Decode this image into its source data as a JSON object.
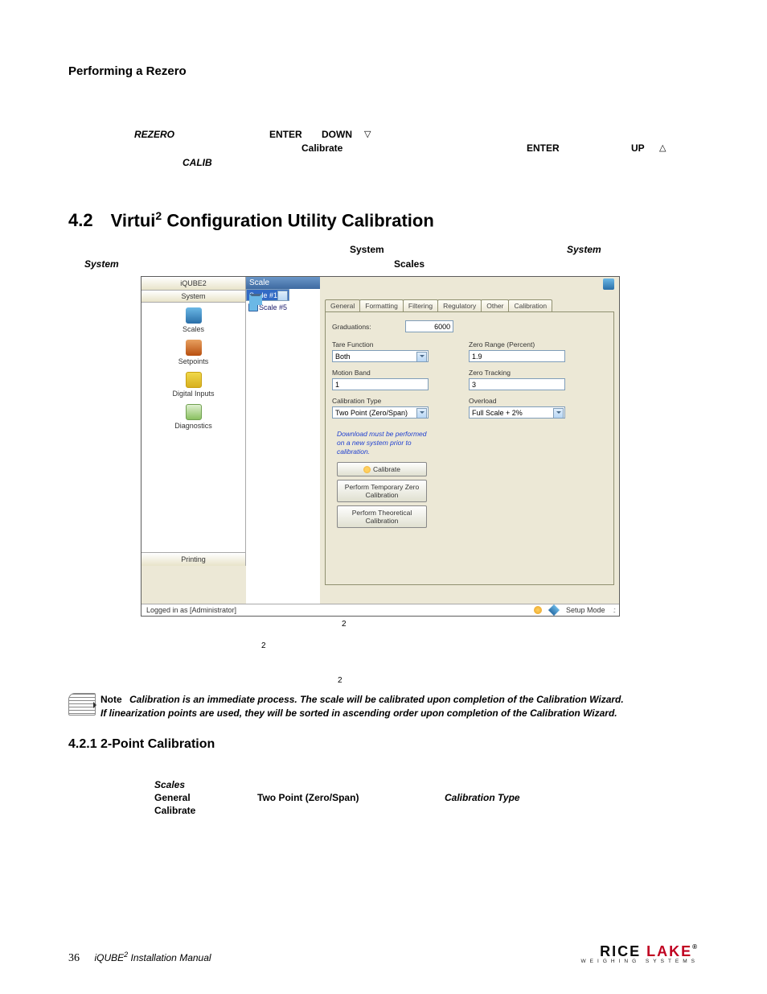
{
  "headings": {
    "rezero": "Performing a Rezero",
    "section_num": "4.2",
    "section_title_a": "Virtui",
    "section_title_sup": "2",
    "section_title_b": " Configuration Utility Calibration",
    "subsection": "4.2.1  2-Point Calibration"
  },
  "keywords1": {
    "rezero": "REZERO",
    "enter": "ENTER",
    "down": "DOWN",
    "calibrate": "Calibrate",
    "calib": "CALIB",
    "enter2": "ENTER",
    "up": "UP"
  },
  "row_above": {
    "system1": "System",
    "system2": "System",
    "system3": "System",
    "scales": "Scales"
  },
  "app": {
    "left_header": "iQUBE2",
    "left_sub": "System",
    "nav": [
      "Scales",
      "Setpoints",
      "Digital Inputs",
      "Diagnostics"
    ],
    "printing": "Printing",
    "mid_title": "Scale",
    "tree": [
      "Scale #1",
      "Scale #5"
    ],
    "tabs": [
      "General",
      "Formatting",
      "Filtering",
      "Regulatory",
      "Other",
      "Calibration"
    ],
    "graduations_label": "Graduations:",
    "graduations_value": "6000",
    "tare_label": "Tare Function",
    "tare_value": "Both",
    "zero_range_label": "Zero Range (Percent)",
    "zero_range_value": "1.9",
    "motion_label": "Motion Band",
    "motion_value": "1",
    "zero_track_label": "Zero Tracking",
    "zero_track_value": "3",
    "cal_type_label": "Calibration Type",
    "cal_type_value": "Two Point (Zero/Span)",
    "overload_label": "Overload",
    "overload_value": "Full Scale + 2%",
    "note": "Download must be performed on a new system prior to calibration.",
    "btn_calibrate": "Calibrate",
    "btn_tempzero": "Perform Temporary Zero Calibration",
    "btn_theor": "Perform Theoretical Calibration",
    "status_left": "Logged in as [Administrator]",
    "status_right": "Setup Mode"
  },
  "floaters": {
    "two_a": "2",
    "two_b": "2",
    "two_c": "2"
  },
  "note_block": {
    "label": "Note",
    "line1": "Calibration is an immediate process. The scale will be calibrated upon completion of the Calibration Wizard.",
    "line2": "If linearization points are used, they will be sorted in ascending order upon completion of the Calibration Wizard."
  },
  "steps": {
    "scales": "Scales",
    "general": "General",
    "twopoint": "Two Point (Zero/Span)",
    "caltype": "Calibration Type",
    "calibrate": "Calibrate"
  },
  "footer": {
    "page": "36",
    "manual_a": "iQUBE",
    "manual_sup": "2",
    "manual_b": " Installation Manual",
    "brand1a": "RICE ",
    "brand1b": "LAKE",
    "brand2": "WEIGHING SYSTEMS"
  }
}
